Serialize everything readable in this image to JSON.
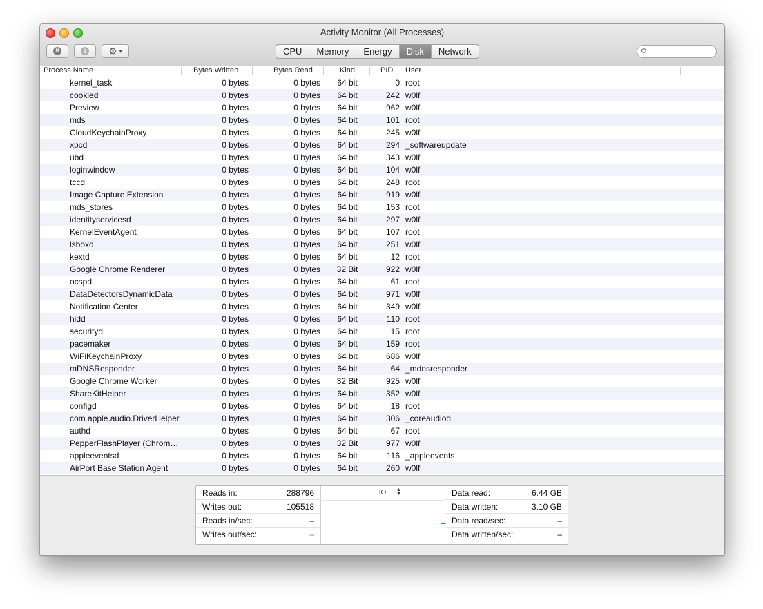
{
  "window": {
    "title": "Activity Monitor (All Processes)"
  },
  "toolbar": {
    "stop_icon": "x-circle-icon",
    "info_icon": "info-circle-icon",
    "action_icon": "gear-icon",
    "action_caret": "▾",
    "tabs": [
      "CPU",
      "Memory",
      "Energy",
      "Disk",
      "Network"
    ],
    "active_tab": "Disk",
    "search_placeholder": ""
  },
  "table": {
    "columns": [
      "Process Name",
      "Bytes Written",
      "Bytes Read",
      "Kind",
      "PID",
      "User"
    ],
    "rows": [
      {
        "name": "kernel_task",
        "written": "0 bytes",
        "read": "0 bytes",
        "kind": "64 bit",
        "pid": "0",
        "user": "root"
      },
      {
        "name": "cookied",
        "written": "0 bytes",
        "read": "0 bytes",
        "kind": "64 bit",
        "pid": "242",
        "user": "w0lf"
      },
      {
        "name": "Preview",
        "written": "0 bytes",
        "read": "0 bytes",
        "kind": "64 bit",
        "pid": "962",
        "user": "w0lf"
      },
      {
        "name": "mds",
        "written": "0 bytes",
        "read": "0 bytes",
        "kind": "64 bit",
        "pid": "101",
        "user": "root"
      },
      {
        "name": "CloudKeychainProxy",
        "written": "0 bytes",
        "read": "0 bytes",
        "kind": "64 bit",
        "pid": "245",
        "user": "w0lf"
      },
      {
        "name": "xpcd",
        "written": "0 bytes",
        "read": "0 bytes",
        "kind": "64 bit",
        "pid": "294",
        "user": "_softwareupdate"
      },
      {
        "name": "ubd",
        "written": "0 bytes",
        "read": "0 bytes",
        "kind": "64 bit",
        "pid": "343",
        "user": "w0lf"
      },
      {
        "name": "loginwindow",
        "written": "0 bytes",
        "read": "0 bytes",
        "kind": "64 bit",
        "pid": "104",
        "user": "w0lf"
      },
      {
        "name": "tccd",
        "written": "0 bytes",
        "read": "0 bytes",
        "kind": "64 bit",
        "pid": "248",
        "user": "root"
      },
      {
        "name": "Image Capture Extension",
        "written": "0 bytes",
        "read": "0 bytes",
        "kind": "64 bit",
        "pid": "919",
        "user": "w0lf"
      },
      {
        "name": "mds_stores",
        "written": "0 bytes",
        "read": "0 bytes",
        "kind": "64 bit",
        "pid": "153",
        "user": "root"
      },
      {
        "name": "identityservicesd",
        "written": "0 bytes",
        "read": "0 bytes",
        "kind": "64 bit",
        "pid": "297",
        "user": "w0lf"
      },
      {
        "name": "KernelEventAgent",
        "written": "0 bytes",
        "read": "0 bytes",
        "kind": "64 bit",
        "pid": "107",
        "user": "root"
      },
      {
        "name": "lsboxd",
        "written": "0 bytes",
        "read": "0 bytes",
        "kind": "64 bit",
        "pid": "251",
        "user": "w0lf"
      },
      {
        "name": "kextd",
        "written": "0 bytes",
        "read": "0 bytes",
        "kind": "64 bit",
        "pid": "12",
        "user": "root"
      },
      {
        "name": "Google Chrome Renderer",
        "written": "0 bytes",
        "read": "0 bytes",
        "kind": "32 Bit",
        "pid": "922",
        "user": "w0lf"
      },
      {
        "name": "ocspd",
        "written": "0 bytes",
        "read": "0 bytes",
        "kind": "64 bit",
        "pid": "61",
        "user": "root"
      },
      {
        "name": "DataDetectorsDynamicData",
        "written": "0 bytes",
        "read": "0 bytes",
        "kind": "64 bit",
        "pid": "971",
        "user": "w0lf"
      },
      {
        "name": "Notification Center",
        "written": "0 bytes",
        "read": "0 bytes",
        "kind": "64 bit",
        "pid": "349",
        "user": "w0lf"
      },
      {
        "name": "hidd",
        "written": "0 bytes",
        "read": "0 bytes",
        "kind": "64 bit",
        "pid": "110",
        "user": "root"
      },
      {
        "name": "securityd",
        "written": "0 bytes",
        "read": "0 bytes",
        "kind": "64 bit",
        "pid": "15",
        "user": "root"
      },
      {
        "name": "pacemaker",
        "written": "0 bytes",
        "read": "0 bytes",
        "kind": "64 bit",
        "pid": "159",
        "user": "root"
      },
      {
        "name": "WiFiKeychainProxy",
        "written": "0 bytes",
        "read": "0 bytes",
        "kind": "64 bit",
        "pid": "686",
        "user": "w0lf"
      },
      {
        "name": "mDNSResponder",
        "written": "0 bytes",
        "read": "0 bytes",
        "kind": "64 bit",
        "pid": "64",
        "user": "_mdnsresponder"
      },
      {
        "name": "Google Chrome Worker",
        "written": "0 bytes",
        "read": "0 bytes",
        "kind": "32 Bit",
        "pid": "925",
        "user": "w0lf"
      },
      {
        "name": "ShareKitHelper",
        "written": "0 bytes",
        "read": "0 bytes",
        "kind": "64 bit",
        "pid": "352",
        "user": "w0lf"
      },
      {
        "name": "configd",
        "written": "0 bytes",
        "read": "0 bytes",
        "kind": "64 bit",
        "pid": "18",
        "user": "root"
      },
      {
        "name": "com.apple.audio.DriverHelper",
        "written": "0 bytes",
        "read": "0 bytes",
        "kind": "64 bit",
        "pid": "306",
        "user": "_coreaudiod"
      },
      {
        "name": "authd",
        "written": "0 bytes",
        "read": "0 bytes",
        "kind": "64 bit",
        "pid": "67",
        "user": "root"
      },
      {
        "name": "PepperFlashPlayer (Chrome…",
        "written": "0 bytes",
        "read": "0 bytes",
        "kind": "32 Bit",
        "pid": "977",
        "user": "w0lf"
      },
      {
        "name": "appleeventsd",
        "written": "0 bytes",
        "read": "0 bytes",
        "kind": "64 bit",
        "pid": "116",
        "user": "_appleevents"
      },
      {
        "name": "AirPort Base Station Agent",
        "written": "0 bytes",
        "read": "0 bytes",
        "kind": "64 bit",
        "pid": "260",
        "user": "w0lf"
      }
    ]
  },
  "stats": {
    "left": [
      {
        "label": "Reads in:",
        "value": "288796"
      },
      {
        "label": "Writes out:",
        "value": "105518"
      },
      {
        "label": "Reads in/sec:",
        "value": "–"
      },
      {
        "label": "Writes out/sec:",
        "value": "–"
      }
    ],
    "io_select": "IO",
    "right": [
      {
        "label": "Data read:",
        "value": "6.44 GB"
      },
      {
        "label": "Data written:",
        "value": "3.10 GB"
      },
      {
        "label": "Data read/sec:",
        "value": "–"
      },
      {
        "label": "Data written/sec:",
        "value": "–"
      }
    ]
  },
  "colors": {
    "row_alt": "#f0f4fa",
    "active_tab": "#8a8a8a",
    "writes_indicator": "#e3542a",
    "reads_indicator": "#d43b2a"
  }
}
